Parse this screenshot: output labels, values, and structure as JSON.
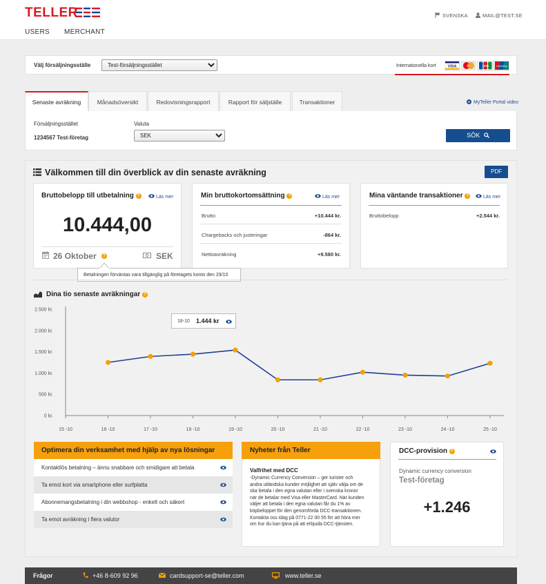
{
  "header": {
    "logo": "TELLER",
    "nav": [
      "USERS",
      "MERCHANT"
    ],
    "language": "SVENSKA",
    "user_email": "MAIL@TEST.SE",
    "brand_color": "#d51920"
  },
  "selector": {
    "label": "Välj försäljningsställe",
    "value": "Test-försäljningsstället",
    "cards_label": "Internationella kort",
    "cards": [
      "VISA",
      "MasterCard",
      "JCB",
      "UnionPay"
    ]
  },
  "tabs": [
    "Senaste avräkning",
    "Månadsöversikt",
    "Redovisningsrapport",
    "Rapport för säljställe",
    "Transaktioner"
  ],
  "portal_video": "MyTeller Portal video",
  "filter": {
    "store_label": "Försäljningsstället",
    "store_value": "1234567 Test-företag",
    "currency_label": "Valuta",
    "currency_value": "SEK",
    "search_button": "SÖK"
  },
  "overview": {
    "title": "Välkommen till din överblick av din senaste avräkning",
    "pdf_button": "PDF",
    "read_more": "Läs mer",
    "payout": {
      "title": "Bruttobelopp till utbetalning",
      "amount": "10.444,00",
      "date": "26 Oktober",
      "currency": "SEK",
      "tooltip": "Betalningen förväntas vara tillgänglig på företagets konto den 29/10"
    },
    "turnover": {
      "title": "Min bruttokortomsättning",
      "rows": [
        {
          "label": "Brutto",
          "value": "+10.444 kr."
        },
        {
          "label": "Chargebacks och justeringar",
          "value": "-864 kr."
        },
        {
          "label": "Nettoavräkning",
          "value": "+9.580 kr."
        }
      ]
    },
    "pending": {
      "title": "Mina väntande transaktioner",
      "rows": [
        {
          "label": "Bruttobelopp",
          "value": "+2.544 kr."
        }
      ]
    }
  },
  "chart_title": "Dina tio senaste avräkningar",
  "chart_data": {
    "type": "line",
    "title": "Dina tio senaste avräkningar",
    "x_ticks": [
      "15 -10",
      "16 -10",
      "17 -10",
      "18 -10",
      "19 -10",
      "20 -10",
      "21 -10",
      "22 -10",
      "23 -10",
      "24 -10",
      "25 -10"
    ],
    "y_ticks": [
      "0 kr.",
      "500 kr.",
      "1.000 kr.",
      "1.500 kr.",
      "2.000 kr.",
      "2.500 kr."
    ],
    "ylim": [
      0,
      2500
    ],
    "series": [
      {
        "points": [
          {
            "x": "16 -10",
            "y": 1250
          },
          {
            "x": "17 -10",
            "y": 1390
          },
          {
            "x": "18 -10",
            "y": 1444
          },
          {
            "x": "19 -10",
            "y": 1540
          },
          {
            "x": "20 -10",
            "y": 840
          },
          {
            "x": "21 -10",
            "y": 840
          },
          {
            "x": "22 -10",
            "y": 1020
          },
          {
            "x": "23 -10",
            "y": 950
          },
          {
            "x": "24 -10",
            "y": 930
          },
          {
            "x": "25 -10",
            "y": 1230
          }
        ],
        "color": "#1c3f94",
        "marker_color": "#f4a000"
      }
    ],
    "tooltip": {
      "x": "18-10",
      "value": "1.444 kr"
    },
    "grid": false
  },
  "optimize": {
    "title": "Optimera din verksamhet med hjälp av nya lösningar",
    "items": [
      "Kontaktlös betalning – ännu snabbare och smidigare att betala",
      "Ta emot kort via smartphone eller surfplatta",
      "Abonnemangsbetalning i din webbshop - enkelt och säkert",
      "Ta emot avräkning i flera valutor"
    ]
  },
  "news": {
    "title": "Nyheter från Teller",
    "heading": "Valfrihet med DCC",
    "lines": [
      "-Dynamic Currency Conversion – ger turister och",
      "andra utländska kunder möjlighet att själv välja om de",
      "ska betala i den egna valutan eller i svenska kronor",
      "när de betalar med Visa eller MasterCard. När kunden",
      "väljer att betala i den egna valutan får du 1% av",
      "köpbeloppet för den genomförda DCC-transaktionen.",
      "Kontakta oss idag på 0771-22 00 55 för att höra mer",
      "om hur du kan tjäna på att erbjuda DCC-tjänsten."
    ]
  },
  "dcc": {
    "title": "DCC-provision",
    "subtitle": "Dynamic currency conversion",
    "company": "Test-företag",
    "value": "+1.246"
  },
  "footer": {
    "title": "Frågor",
    "phone": "+46 8-609 92 96",
    "email": "cardsupport-se@teller.com",
    "web": "www.teller.se"
  },
  "colors": {
    "accent": "#f4a000",
    "blue": "#154e8f",
    "red": "#d51920"
  }
}
